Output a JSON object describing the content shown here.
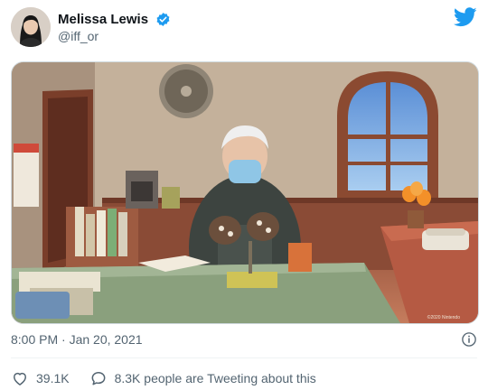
{
  "tweet": {
    "author_name": "Melissa Lewis",
    "author_handle": "@iff_or",
    "verified": true,
    "timestamp": "8:00 PM · Jan 20, 2021",
    "likes": "39.1K",
    "tweeting_text": "8.3K people are Tweeting about this",
    "media_watermark": "©2020 Nintendo"
  },
  "colors": {
    "twitter_blue": "#1d9bf0",
    "secondary_text": "#536471",
    "primary_text": "#0f1419"
  },
  "icons": {
    "brand": "twitter-bird-icon",
    "verified": "verified-badge-icon",
    "info": "info-icon",
    "like": "heart-icon",
    "reply": "speech-bubble-icon"
  }
}
